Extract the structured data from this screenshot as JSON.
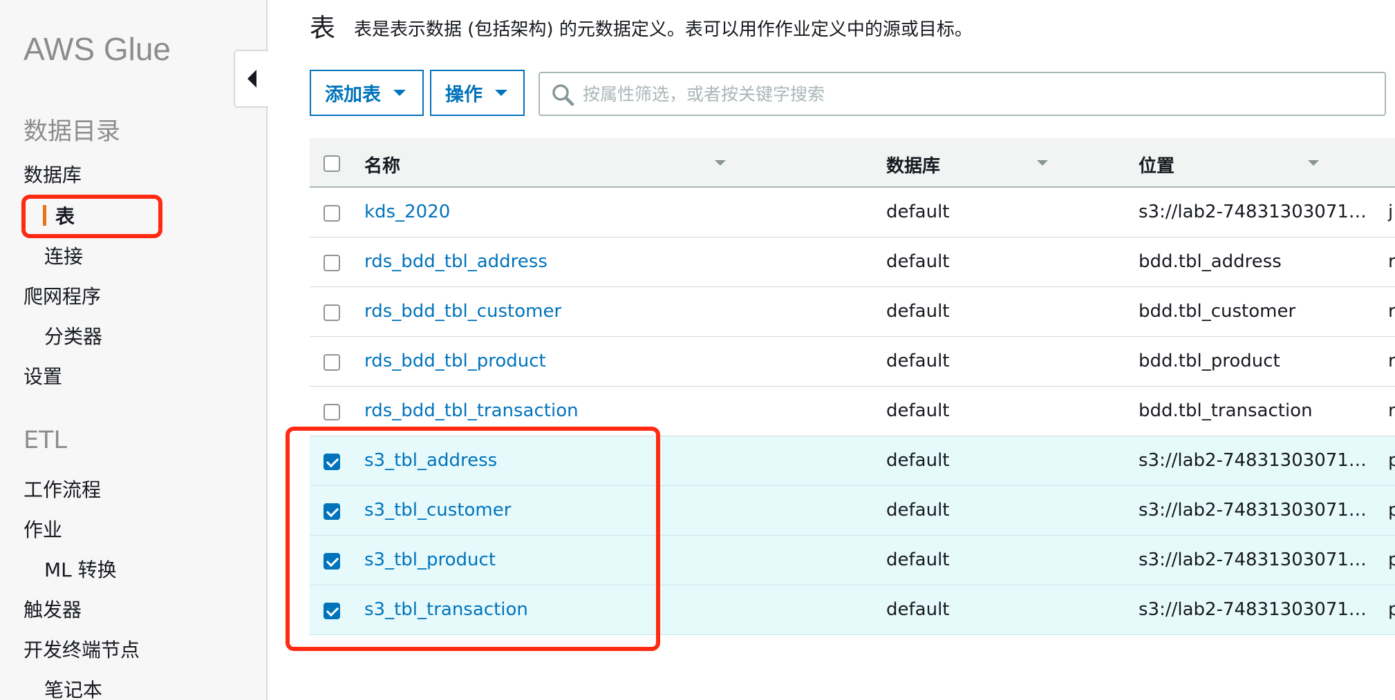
{
  "sidebar": {
    "app_title": "AWS Glue",
    "sections": [
      {
        "label": "数据目录"
      },
      {
        "label": "ETL"
      }
    ],
    "items": [
      {
        "label": "数据库"
      },
      {
        "label": "表"
      },
      {
        "label": "连接"
      },
      {
        "label": "爬网程序"
      },
      {
        "label": "分类器"
      },
      {
        "label": "设置"
      },
      {
        "label": "工作流程"
      },
      {
        "label": "作业"
      },
      {
        "label": "ML 转换"
      },
      {
        "label": "触发器"
      },
      {
        "label": "开发终端节点"
      },
      {
        "label": "笔记本"
      }
    ],
    "active_item": "表",
    "active_color": "#ec7211"
  },
  "header": {
    "title": "表",
    "description": "表是表示数据 (包括架构) 的元数据定义。表可以用作作业定义中的源或目标。"
  },
  "toolbar": {
    "add_label": "添加表",
    "action_label": "操作",
    "search_placeholder": "按属性筛选，或者按关键字搜索",
    "search_value": ""
  },
  "table": {
    "columns": [
      "名称",
      "数据库",
      "位置"
    ],
    "rows": [
      {
        "name": "kds_2020",
        "database": "default",
        "location": "s3://lab2-748313030715...",
        "extra": "j",
        "checked": false
      },
      {
        "name": "rds_bdd_tbl_address",
        "database": "default",
        "location": "bdd.tbl_address",
        "extra": "r",
        "checked": false
      },
      {
        "name": "rds_bdd_tbl_customer",
        "database": "default",
        "location": "bdd.tbl_customer",
        "extra": "r",
        "checked": false
      },
      {
        "name": "rds_bdd_tbl_product",
        "database": "default",
        "location": "bdd.tbl_product",
        "extra": "r",
        "checked": false
      },
      {
        "name": "rds_bdd_tbl_transaction",
        "database": "default",
        "location": "bdd.tbl_transaction",
        "extra": "r",
        "checked": false
      },
      {
        "name": "s3_tbl_address",
        "database": "default",
        "location": "s3://lab2-748313030715...",
        "extra": "p",
        "checked": true
      },
      {
        "name": "s3_tbl_customer",
        "database": "default",
        "location": "s3://lab2-748313030715...",
        "extra": "p",
        "checked": true
      },
      {
        "name": "s3_tbl_product",
        "database": "default",
        "location": "s3://lab2-748313030715...",
        "extra": "p",
        "checked": true
      },
      {
        "name": "s3_tbl_transaction",
        "database": "default",
        "location": "s3://lab2-748313030715...",
        "extra": "p",
        "checked": true
      }
    ]
  },
  "colors": {
    "link": "#0073bb",
    "selected_row": "#e6fafc",
    "annotation": "#ff2a12"
  }
}
